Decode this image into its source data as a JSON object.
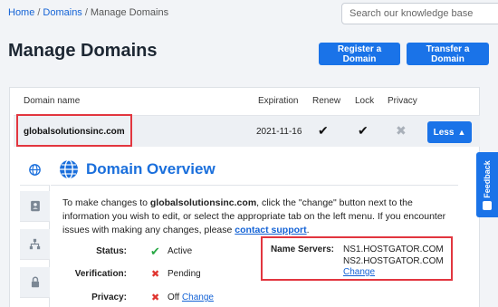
{
  "breadcrumb": {
    "home": "Home",
    "domains": "Domains",
    "current": "Manage Domains",
    "sep": "/"
  },
  "search": {
    "placeholder": "Search our knowledge base"
  },
  "page": {
    "title": "Manage Domains"
  },
  "actions": {
    "register": "Register a Domain",
    "transfer": "Transfer a Domain"
  },
  "table": {
    "headers": {
      "domain": "Domain name",
      "expiration": "Expiration",
      "renew": "Renew",
      "lock": "Lock",
      "privacy": "Privacy"
    },
    "row": {
      "domain": "globalsolutionsinc.com",
      "expiration": "2021-11-16",
      "renew": true,
      "lock": true,
      "privacy": false,
      "toggle": "Less"
    }
  },
  "overview": {
    "title": "Domain Overview",
    "intro_pre": "To make changes to ",
    "intro_domain": "globalsolutionsinc.com",
    "intro_mid": ", click the \"change\" button next to the information you wish to edit, or select the appropriate tab on the left menu. If you encounter issues with making any changes, please ",
    "intro_link": "contact support",
    "intro_end": ".",
    "status_label": "Status:",
    "status_value": "Active",
    "verification_label": "Verification:",
    "verification_value": "Pending",
    "privacy_label": "Privacy:",
    "privacy_value": "Off",
    "privacy_change": "Change",
    "ns_label": "Name Servers:",
    "ns1": "NS1.HOSTGATOR.COM",
    "ns2": "NS2.HOSTGATOR.COM",
    "ns_change": "Change"
  },
  "feedback": {
    "label": "Feedback"
  },
  "colors": {
    "accent": "#1a73e8",
    "highlight": "#e2363f",
    "success": "#27a844",
    "error": "#e0342f"
  }
}
